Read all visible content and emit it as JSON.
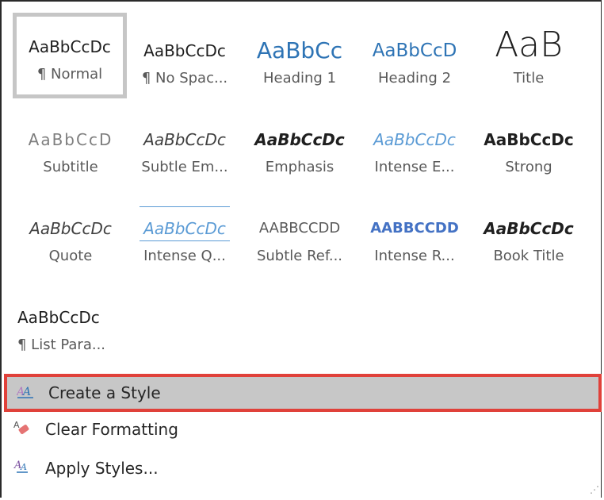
{
  "styles": [
    {
      "preview": "AaBbCcDc",
      "name": "¶ Normal"
    },
    {
      "preview": "AaBbCcDc",
      "name": "¶ No Spac..."
    },
    {
      "preview": "AaBbCc",
      "name": "Heading 1"
    },
    {
      "preview": "AaBbCcD",
      "name": "Heading 2"
    },
    {
      "preview": "AaB",
      "name": "Title"
    },
    {
      "preview": "AaBbCcD",
      "name": "Subtitle"
    },
    {
      "preview": "AaBbCcDc",
      "name": "Subtle Em..."
    },
    {
      "preview": "AaBbCcDc",
      "name": "Emphasis"
    },
    {
      "preview": "AaBbCcDc",
      "name": "Intense E..."
    },
    {
      "preview": "AaBbCcDc",
      "name": "Strong"
    },
    {
      "preview": "AaBbCcDc",
      "name": "Quote"
    },
    {
      "preview": "AaBbCcDc",
      "name": "Intense Q..."
    },
    {
      "preview": "AABBCCDD",
      "name": "Subtle Ref..."
    },
    {
      "preview": "AABBCCDD",
      "name": "Intense R..."
    },
    {
      "preview": "AaBbCcDc",
      "name": "Book Title"
    },
    {
      "preview": "AaBbCcDc",
      "name": "¶ List Para..."
    }
  ],
  "commands": {
    "create_style": "Create a Style",
    "clear_formatting": "Clear Formatting",
    "apply_styles": "Apply Styles..."
  },
  "colors": {
    "heading_blue": "#2e74b5",
    "intense_blue": "#4472c4",
    "highlight_border": "#e0413a",
    "highlight_fill": "#c7c7c7"
  }
}
